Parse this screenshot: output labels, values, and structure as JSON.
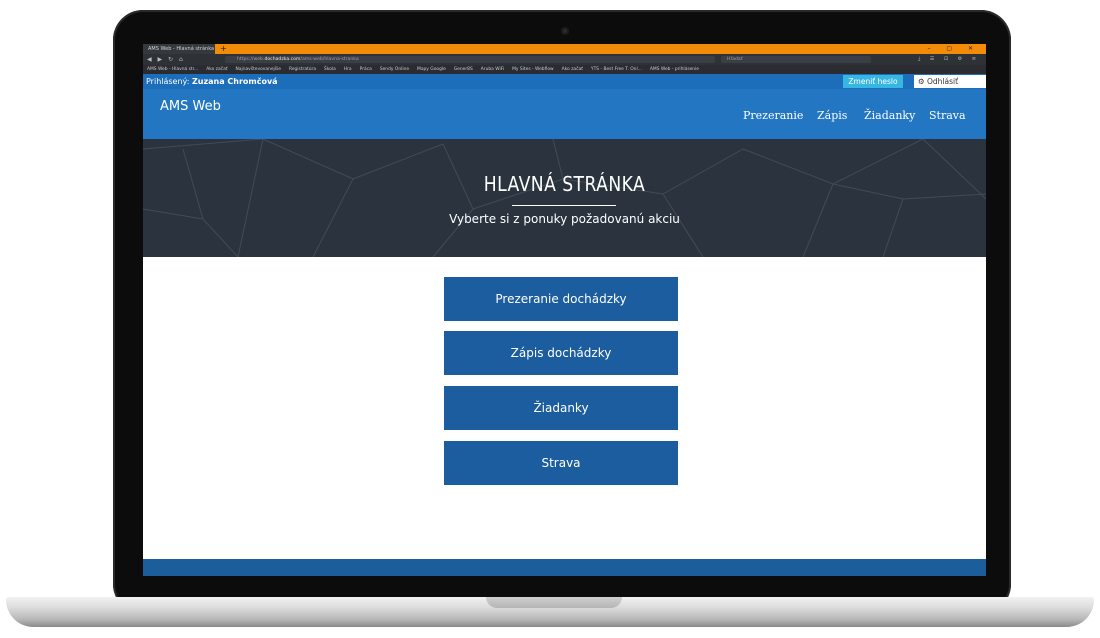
{
  "browser": {
    "tab_title": "AMS Web - Hlavná stránka",
    "new_tab": "+",
    "window_controls": "– ▢ ✕",
    "nav_arrows": "◀ ▶ ↻ ⌂",
    "url_prefix": "https://web.",
    "url_domain": "dochadzka.com",
    "url_path": "/ams-web/hlavna-stranka",
    "search_placeholder": "Hľadať",
    "toolbar_icons": "⤓ ☰ ⊡ ⚙ ≡",
    "bookmarks": [
      "AMS Web - Hlavná str...",
      "Ako začať",
      "Najnavštevovanejšie",
      "Registratúra",
      "Škola",
      "Hra",
      "Práca",
      "Sendy Online",
      "Mapy Google",
      "Gener8S",
      "Aruba WiFi",
      "My Sites - Webflow",
      "Ako začať",
      "YTS - Best Free T. Onl...",
      "AMS Web - prihlásenie"
    ]
  },
  "topbar": {
    "logged_label": "Prihlásený:",
    "user_name": "Zuzana Chromčová",
    "change_password": "Zmeniť heslo",
    "logout": "Odhlásiť"
  },
  "nav": {
    "brand": "AMS Web",
    "items": [
      "Prezeranie",
      "Zápis",
      "Žiadanky",
      "Strava"
    ]
  },
  "hero": {
    "title": "HLAVNÁ STRÁNKA",
    "subtitle": "Vyberte si z ponuky požadovanú akciu"
  },
  "actions": [
    "Prezeranie dochádzky",
    "Zápis dochádzky",
    "Žiadanky",
    "Strava"
  ],
  "colors": {
    "primary": "#2276c2",
    "button": "#1b5d9f",
    "accent": "#36b6e0",
    "hero_bg": "#2b343e"
  }
}
